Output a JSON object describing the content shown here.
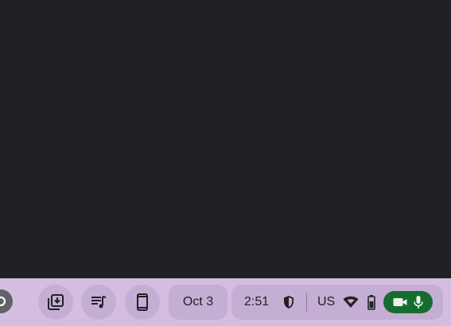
{
  "shelf": {
    "background": "#d3bde0",
    "buttons": [
      {
        "icon": "holding-space-icon"
      },
      {
        "icon": "media-controls-icon"
      },
      {
        "icon": "phone-hub-icon"
      }
    ],
    "date": "Oct 3",
    "status": {
      "time": "2:51",
      "ime": "US",
      "indicators": [
        "managed-shield-icon",
        "wifi-icon",
        "battery-icon"
      ],
      "capture_indicator": {
        "color": "#146c2e",
        "icons": [
          "camera-icon",
          "microphone-icon"
        ]
      }
    }
  }
}
